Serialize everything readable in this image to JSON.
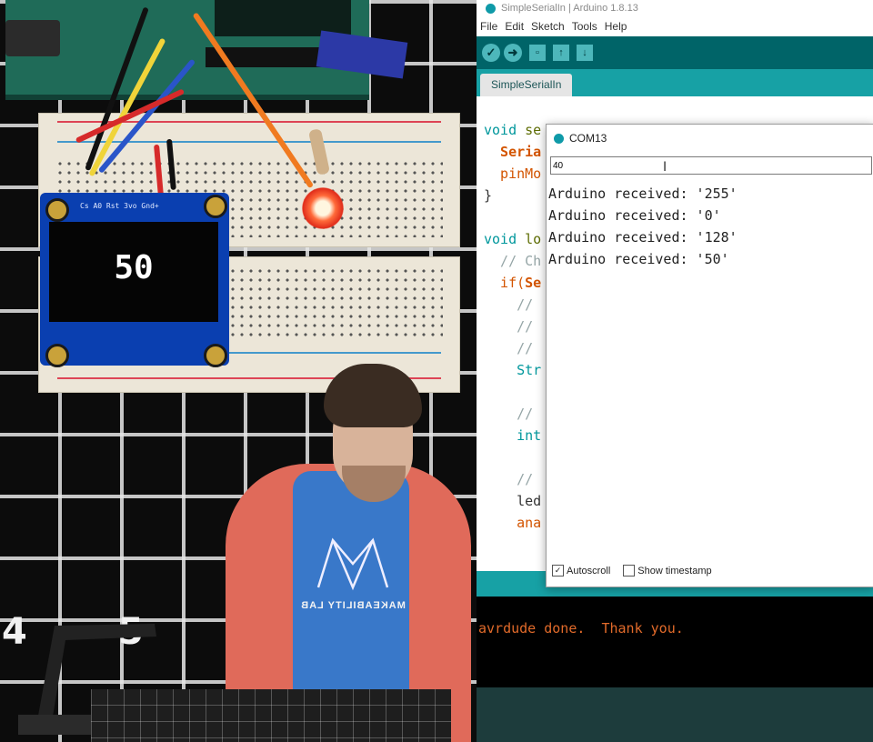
{
  "scene": {
    "oled_reading": "50",
    "oled_pin_labels": "Cs A0 Rst  3vo  Gnd+",
    "ruler_number_1": "4",
    "ruler_number_2": "5",
    "shirt_text": "MAKEABILITY LAB",
    "led_color": "#e02c1a"
  },
  "ide": {
    "window_title": "SimpleSerialIn | Arduino 1.8.13",
    "menu": [
      "File",
      "Edit",
      "Sketch",
      "Tools",
      "Help"
    ],
    "toolbar_icons": [
      "verify-icon",
      "upload-icon",
      "new-icon",
      "open-icon",
      "save-icon"
    ],
    "tab_label": "SimpleSerialIn",
    "code_fragments": {
      "line1_kw": "void",
      "line1_rest": " se",
      "line2": "  Seria",
      "line3": "  pinMo",
      "line4": "}",
      "line5_kw": "void",
      "line5_rest": " lo",
      "line6": "  // Ch",
      "line7_kw": "  if(",
      "line7_rest": "Se",
      "line8": "    //",
      "line9": "    //",
      "line10": "    //",
      "line11": "    Str",
      "line12": "    //",
      "line13": "    int",
      "line14": "    //",
      "line15": "    led",
      "line16": "    ana"
    },
    "console_output": "avrdude done.  Thank you.",
    "accent_color": "#17a1a5",
    "toolbar_color": "#006468"
  },
  "serial_monitor": {
    "title": "COM13",
    "input_value": "40",
    "caret_glyph": "I",
    "output_lines": [
      "Arduino received: '255'",
      "Arduino received: '0'",
      "Arduino received: '128'",
      "Arduino received: '50'"
    ],
    "autoscroll_label": "Autoscroll",
    "autoscroll_checked": true,
    "timestamp_label": "Show timestamp",
    "timestamp_checked": false
  }
}
